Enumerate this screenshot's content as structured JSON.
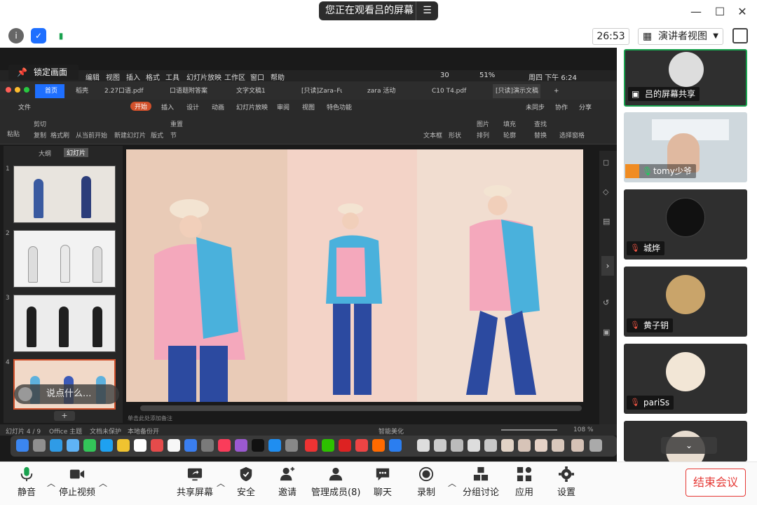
{
  "header": {
    "viewing_label": "您正在观看吕的屏幕",
    "timer": "26:53",
    "view_mode": "演讲者视图"
  },
  "share": {
    "lock_label": "锁定画面",
    "chat_placeholder": "说点什么...",
    "mac_menu": [
      "编辑",
      "视图",
      "插入",
      "格式",
      "工具",
      "幻灯片放映",
      "工作区",
      "窗口",
      "帮助"
    ],
    "mac_status": {
      "battery": "51%",
      "clock": "周四 下午 6:24",
      "notif_count": "30"
    },
    "wps_tabs": [
      "首页",
      "稻壳",
      "2.27口语.pdf",
      "口语题附答案",
      "文字文稿1",
      "[只读]Zara–Fu",
      "zara 活动",
      "C10 T4.pdf",
      "[只读]演示文稿"
    ],
    "wps_menu": [
      "文件",
      "开始",
      "插入",
      "设计",
      "动画",
      "幻灯片放映",
      "审阅",
      "视图",
      "特色功能"
    ],
    "wps_menu_right": [
      "未同步",
      "协作",
      "分享"
    ],
    "ribbon": [
      "粘贴",
      "剪切",
      "复制",
      "格式刷",
      "从当前开始",
      "新建幻灯片",
      "版式",
      "重置",
      "节",
      "文本框",
      "形状",
      "图片",
      "排列",
      "填充",
      "轮廓",
      "查找",
      "替换",
      "选择窗格"
    ],
    "panel_tabs": [
      "大纲",
      "幻灯片"
    ],
    "slide_numbers": [
      "1",
      "2",
      "3",
      "4"
    ],
    "notes_placeholder": "单击此处添加备注",
    "status_left": [
      "幻灯片 4 / 9",
      "Office 主题",
      "文档未保护",
      "本地备份开"
    ],
    "status_right": [
      "智能美化",
      "108 %"
    ]
  },
  "participants": [
    {
      "name": "吕的屏幕共享",
      "muted": false
    },
    {
      "name": "tomy少爷",
      "muted": false
    },
    {
      "name": "城烨",
      "muted": true
    },
    {
      "name": "黄子钥",
      "muted": true
    },
    {
      "name": "pariSs",
      "muted": true
    }
  ],
  "toolbar": {
    "mute": "静音",
    "stop_video": "停止视频",
    "share_screen": "共享屏幕",
    "security": "安全",
    "invite": "邀请",
    "manage_members": "管理成员(8)",
    "chat": "聊天",
    "record": "录制",
    "breakout": "分组讨论",
    "apps": "应用",
    "settings": "设置",
    "end_meeting": "结束会议"
  },
  "colors": {
    "accent": "#1e6fff",
    "danger": "#e53935",
    "green": "#19a14e",
    "wps_active": "#d1502b"
  }
}
